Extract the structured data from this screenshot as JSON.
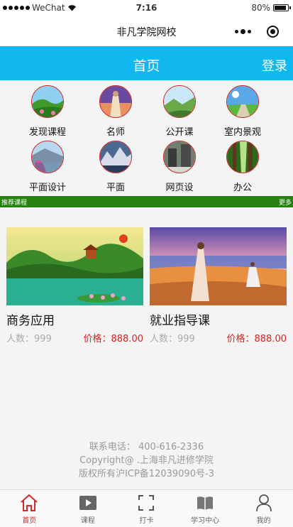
{
  "status_bar": {
    "carrier": "WeChat",
    "time": "7:16",
    "battery": "80%"
  },
  "nav": {
    "title": "非凡学院网校"
  },
  "header": {
    "title": "首页",
    "login": "登录"
  },
  "categories": [
    {
      "label": "发现课程"
    },
    {
      "label": "名师"
    },
    {
      "label": "公开课"
    },
    {
      "label": "室内景观"
    },
    {
      "label": "平面设计"
    },
    {
      "label": "平面"
    },
    {
      "label": "网页设"
    },
    {
      "label": "办公"
    }
  ],
  "recommend": {
    "title": "推荐课程",
    "more": "更多"
  },
  "courses": [
    {
      "name": "商务应用",
      "people": "人数：999",
      "price": "价格：888.00"
    },
    {
      "name": "就业指导课",
      "people": "人数：999",
      "price": "价格：888.00"
    }
  ],
  "footer": {
    "phone": "联系电话： 400-616-2336",
    "copyright": "Copyright@ .上海非凡进修学院",
    "icp": "版权所有沪ICP备12039090号-3"
  },
  "tabbar": [
    {
      "label": "首页",
      "icon": "home-icon",
      "active": true
    },
    {
      "label": "课程",
      "icon": "play-icon"
    },
    {
      "label": "打卡",
      "icon": "scan-icon"
    },
    {
      "label": "学习中心",
      "icon": "book-icon"
    },
    {
      "label": "我的",
      "icon": "user-icon"
    }
  ],
  "colors": {
    "header": "#11b8ef",
    "strip": "#26820e",
    "price": "#e0201c",
    "active_tab": "#d12b2b"
  }
}
